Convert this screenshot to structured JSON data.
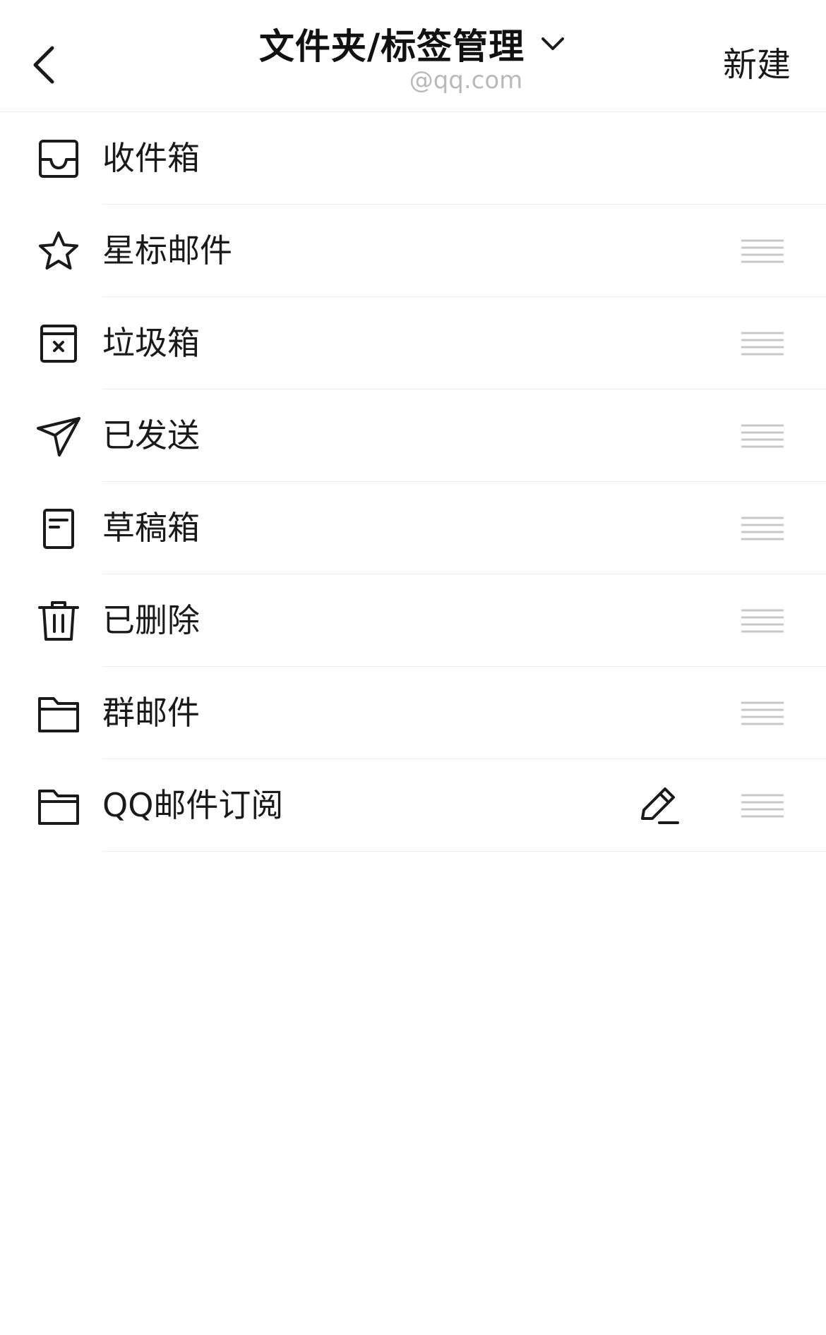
{
  "header": {
    "title": "文件夹/标签管理",
    "account": "@qq.com",
    "new_label": "新建"
  },
  "folders": [
    {
      "label": "收件箱",
      "icon": "inbox-icon"
    },
    {
      "label": "星标邮件",
      "icon": "star-icon"
    },
    {
      "label": "垃圾箱",
      "icon": "spam-box-icon"
    },
    {
      "label": "已发送",
      "icon": "send-icon"
    },
    {
      "label": "草稿箱",
      "icon": "draft-icon"
    },
    {
      "label": "已删除",
      "icon": "trash-icon"
    },
    {
      "label": "群邮件",
      "icon": "folder-icon"
    },
    {
      "label": "QQ邮件订阅",
      "icon": "folder-icon"
    }
  ]
}
